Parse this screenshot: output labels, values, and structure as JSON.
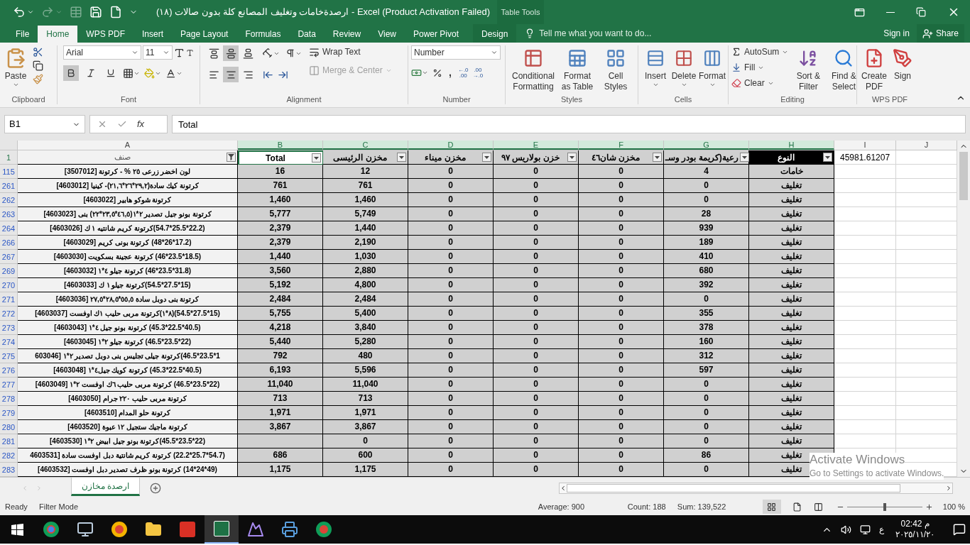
{
  "title_bar": {
    "title": "ارصدةخامات وتغليف المصانع كلة بدون صالات (١٨) - Excel (Product Activation Failed)",
    "context_label": "Table Tools"
  },
  "menu_tabs": [
    {
      "label": "File",
      "selected": false
    },
    {
      "label": "Home",
      "selected": true
    },
    {
      "label": "WPS PDF",
      "selected": false
    },
    {
      "label": "Insert",
      "selected": false
    },
    {
      "label": "Page Layout",
      "selected": false
    },
    {
      "label": "Formulas",
      "selected": false
    },
    {
      "label": "Data",
      "selected": false
    },
    {
      "label": "Review",
      "selected": false
    },
    {
      "label": "View",
      "selected": false
    },
    {
      "label": "Power Pivot",
      "selected": false
    },
    {
      "label": "Design",
      "selected": false
    }
  ],
  "tell_me": {
    "placeholder": "Tell me what you want to do..."
  },
  "account": {
    "sign_in": "Sign in",
    "share": "Share"
  },
  "ribbon": {
    "clipboard": {
      "label": "Clipboard",
      "paste": "Paste"
    },
    "font": {
      "label": "Font",
      "font_name": "Arial",
      "font_size": "11",
      "bold": true,
      "italic": false,
      "underline": false
    },
    "alignment": {
      "label": "Alignment",
      "wrap_text": "Wrap Text",
      "merge": "Merge & Center",
      "merge_disabled": true,
      "middle": true,
      "center": true
    },
    "number": {
      "label": "Number",
      "format": "Number",
      "comma": ",",
      "decimals": [
        {
          "top": "←.0",
          "bottom": ".00"
        },
        {
          "top": ".00",
          "bottom": "→.0"
        }
      ]
    },
    "styles": {
      "label": "Styles",
      "buttons": [
        "Conditional Formatting",
        "Format as Table",
        "Cell Styles"
      ]
    },
    "cells": {
      "label": "Cells",
      "buttons": [
        "Insert",
        "Delete",
        "Format"
      ]
    },
    "editing": {
      "label": "Editing",
      "small": [
        "AutoSum",
        "Fill",
        "Clear"
      ],
      "big": [
        "Sort & Filter",
        "Find & Select"
      ]
    },
    "wps_pdf": {
      "label": "WPS PDF",
      "buttons": [
        "Create PDF",
        "Sign"
      ]
    }
  },
  "formula_bar": {
    "name_box": "B1",
    "function_label": "fx",
    "value": "Total"
  },
  "columns": [
    {
      "letter": "A",
      "selected": false
    },
    {
      "letter": "B",
      "selected": true
    },
    {
      "letter": "C",
      "selected": true
    },
    {
      "letter": "D",
      "selected": true
    },
    {
      "letter": "E",
      "selected": true
    },
    {
      "letter": "F",
      "selected": true
    },
    {
      "letter": "G",
      "selected": true
    },
    {
      "letter": "H",
      "selected": true
    },
    {
      "letter": "I",
      "selected": false
    },
    {
      "letter": "J",
      "selected": false
    }
  ],
  "header_row": {
    "row": "1",
    "cells": {
      "a": {
        "text": "صنف",
        "filter_applied": true,
        "selected": false,
        "dark": false
      },
      "b": {
        "text": "Total",
        "filter_applied": false,
        "selected": true,
        "dark": false
      },
      "c": {
        "text": "مخزن الرئيسى",
        "filter_applied": false,
        "selected": false,
        "dark": false
      },
      "d": {
        "text": "مخزن ميناء",
        "filter_applied": false,
        "selected": false,
        "dark": false
      },
      "e": {
        "text": "خزن بولاريس ٩٧",
        "filter_applied": false,
        "selected": false,
        "dark": false
      },
      "f": {
        "text": "مخزن شان٤٦",
        "filter_applied": false,
        "selected": false,
        "dark": false
      },
      "g": {
        "text": "رعية(كريمة بودر وسـ",
        "filter_applied": false,
        "selected": false,
        "dark": false
      },
      "h": {
        "text": "النوع",
        "filter_applied": false,
        "selected": false,
        "dark": true
      }
    },
    "extra": "45981.61207"
  },
  "rows": [
    {
      "row": "115",
      "item": "لون اخضر زرعى ٢٥ % - كرتونة [3507012]",
      "total": "16",
      "main": "12",
      "mina": "0",
      "polaris": "0",
      "shan": "0",
      "column_g": "4",
      "type": "خامات"
    },
    {
      "row": "261",
      "item": "كرتونة كيك سادة(٢٩,٢*٢٦*٢١,٦)- كينيا [4603012]",
      "total": "761",
      "main": "761",
      "mina": "0",
      "polaris": "0",
      "shan": "0",
      "column_g": "0",
      "type": "تغليف"
    },
    {
      "row": "262",
      "item": "كرتونة شوكو هابير [4603022]",
      "total": "1,460",
      "main": "1,460",
      "mina": "0",
      "polaris": "0",
      "shan": "0",
      "column_g": "0",
      "type": "تغليف"
    },
    {
      "row": "263",
      "item": "كرتونة بونو جيل تصدير ٢*١(٤٦,٥*٢٣,٥*٢٢) بنى [4603023]",
      "total": "5,777",
      "main": "5,749",
      "mina": "0",
      "polaris": "0",
      "shan": "0",
      "column_g": "28",
      "type": "تغليف"
    },
    {
      "row": "264",
      "item": "(22.2*25.5*54.7)كرتونة كريم شانتيه ١ ك [4603026]",
      "total": "2,379",
      "main": "1,440",
      "mina": "0",
      "polaris": "0",
      "shan": "0",
      "column_g": "939",
      "type": "تغليف"
    },
    {
      "row": "266",
      "item": "(17.2*26*48) كرتونة بونى كريم [4603029]",
      "total": "2,379",
      "main": "2,190",
      "mina": "0",
      "polaris": "0",
      "shan": "0",
      "column_g": "189",
      "type": "تغليف"
    },
    {
      "row": "267",
      "item": "(18.5*23.5*46) كرتونة عجينة بسكويت [4603030]",
      "total": "1,440",
      "main": "1,030",
      "mina": "0",
      "polaris": "0",
      "shan": "0",
      "column_g": "410",
      "type": "تغليف"
    },
    {
      "row": "269",
      "item": "(31.8*23.5*46) كرتونة جيلو ٤*١ [4603032]",
      "total": "3,560",
      "main": "2,880",
      "mina": "0",
      "polaris": "0",
      "shan": "0",
      "column_g": "680",
      "type": "تغليف"
    },
    {
      "row": "270",
      "item": "(15*27.5*54.5)كرتونة جيلو ١ ك [4603033]",
      "total": "5,192",
      "main": "4,800",
      "mina": "0",
      "polaris": "0",
      "shan": "0",
      "column_g": "392",
      "type": "تغليف"
    },
    {
      "row": "271",
      "item": "كرتونة بنى دوبل سادة ٥٥,٥*٢٨,٥*٢٧,٥ [4603036]",
      "total": "2,484",
      "main": "2,484",
      "mina": "0",
      "polaris": "0",
      "shan": "0",
      "column_g": "0",
      "type": "تغليف"
    },
    {
      "row": "272",
      "item": "(15*27.5*54.5)(٨*١)كرتونة مربى حليب ١ك اوفست [4603037]",
      "total": "5,755",
      "main": "5,400",
      "mina": "0",
      "polaris": "0",
      "shan": "0",
      "column_g": "355",
      "type": "تغليف"
    },
    {
      "row": "273",
      "item": "(40.5*22.5*45.3) كرتونة بونو جيل ٤*١ [4603043]",
      "total": "4,218",
      "main": "3,840",
      "mina": "0",
      "polaris": "0",
      "shan": "0",
      "column_g": "378",
      "type": "تغليف"
    },
    {
      "row": "274",
      "item": "(22*23.5*46.5) كرتونة جيلو ٢*١ [4603045]",
      "total": "5,440",
      "main": "5,280",
      "mina": "0",
      "polaris": "0",
      "shan": "0",
      "column_g": "160",
      "type": "تغليف"
    },
    {
      "row": "275",
      "item": "1*23.5*46.5)كرتونة جيلى تجليس بنى دوبل تصدير ٢*١ [603046",
      "total": "792",
      "main": "480",
      "mina": "0",
      "polaris": "0",
      "shan": "0",
      "column_g": "312",
      "type": "تغليف"
    },
    {
      "row": "276",
      "item": "(40.5*22.5*45.3) كرتونة كويك جيل٤*١ [4603048]",
      "total": "6,193",
      "main": "5,596",
      "mina": "0",
      "polaris": "0",
      "shan": "0",
      "column_g": "597",
      "type": "تغليف"
    },
    {
      "row": "277",
      "item": "(22*23.5*46.5) كرتونة مربى حليب ٦ك اوفست ٢*١ [4603049]",
      "total": "11,040",
      "main": "11,040",
      "mina": "0",
      "polaris": "0",
      "shan": "0",
      "column_g": "0",
      "type": "تغليف"
    },
    {
      "row": "278",
      "item": "كرتونة مربى حليب ٢٢٠ جرام [4603050]",
      "total": "713",
      "main": "713",
      "mina": "0",
      "polaris": "0",
      "shan": "0",
      "column_g": "0",
      "type": "تغليف"
    },
    {
      "row": "279",
      "item": "كرتونة حلو المدام [4603510]",
      "total": "1,971",
      "main": "1,971",
      "mina": "0",
      "polaris": "0",
      "shan": "0",
      "column_g": "0",
      "type": "تغليف"
    },
    {
      "row": "280",
      "item": "كرتونة ماجيك ستجيل ١٢ عبوة [4603520]",
      "total": "3,867",
      "main": "3,867",
      "mina": "0",
      "polaris": "0",
      "shan": "0",
      "column_g": "0",
      "type": "تغليف"
    },
    {
      "row": "281",
      "item": "(22*23.5*45.5)كرتونة بونو جيل ابيض ٢*١ [4603530]",
      "main": "0",
      "mina": "0",
      "polaris": "0",
      "shan": "0",
      "column_g": "0",
      "type": "تغليف"
    },
    {
      "row": "282",
      "item": "(54.7*25.7*22.2) كرتونة كريم شانتية دبل اوفست سادة [4603531",
      "total": "686",
      "main": "600",
      "mina": "0",
      "polaris": "0",
      "shan": "0",
      "column_g": "86",
      "type": "تغليف"
    },
    {
      "row": "283",
      "item": "(49*24*14) كرتونة بونو ظرف تصدير دبل اوفست [4603532]",
      "total": "1,175",
      "main": "1,175",
      "mina": "0",
      "polaris": "0",
      "shan": "0",
      "column_g": "0",
      "type": "تغليف"
    }
  ],
  "sheet_tabs": [
    {
      "label": "ارصدة مخازن",
      "selected": true
    }
  ],
  "activation_notice": {
    "title": "Activate Windows",
    "text": "Go to Settings to activate Windows."
  },
  "status_bar": {
    "mode": "Ready",
    "filter": "Filter Mode",
    "average": "Average: 900",
    "count": "Count: 188",
    "sum": "Sum: 139,522",
    "zoom": "100 %",
    "zoom_slider": {
      "level": 0.5
    }
  },
  "taskbar": {
    "input_language": "ع",
    "time": "02:42 م",
    "date": "٢٠٢٥/١١/٢٠"
  }
}
